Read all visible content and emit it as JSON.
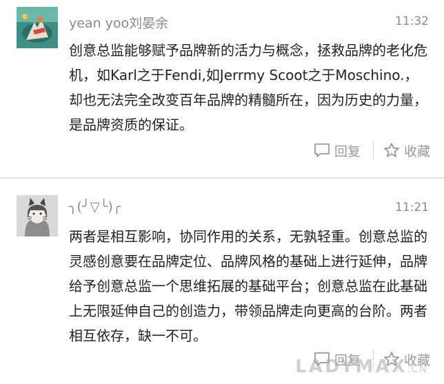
{
  "comments": [
    {
      "username": "yean yoo刘晏余",
      "time": "11:32",
      "text": "创意总监能够赋予品牌新的活力与概念，拯救品牌的老化危机，如Karl之于Fendi,如Jerrmy Scoot之于Moschino.，却也无法完全改变百年品牌的精髓所在，因为历史的力量，是品牌资质的保证。",
      "reply_label": "回复",
      "favorite_label": "收藏"
    },
    {
      "username": "╮(╯▽╰)╭",
      "time": "11:21",
      "text": "两者是相互影响，协同作用的关系，无孰轻重。创意总监的灵感创意要在品牌定位、品牌风格的基础上进行延伸，品牌给予创意总监一个思维拓展的基础平台；创意总监在此基础上无限延伸自己的创造力，带领品牌走向更高的台阶。两者相互依存，缺一不可。",
      "reply_label": "回复",
      "favorite_label": "收藏"
    }
  ],
  "watermark": {
    "main": "LADYMAX",
    "suffix": ".CN"
  },
  "colors": {
    "meta_text": "#8a8a8a",
    "icon": "#9a9a9a",
    "body_text": "#222222"
  },
  "icons": [
    "comment-bubble-icon",
    "star-icon"
  ]
}
